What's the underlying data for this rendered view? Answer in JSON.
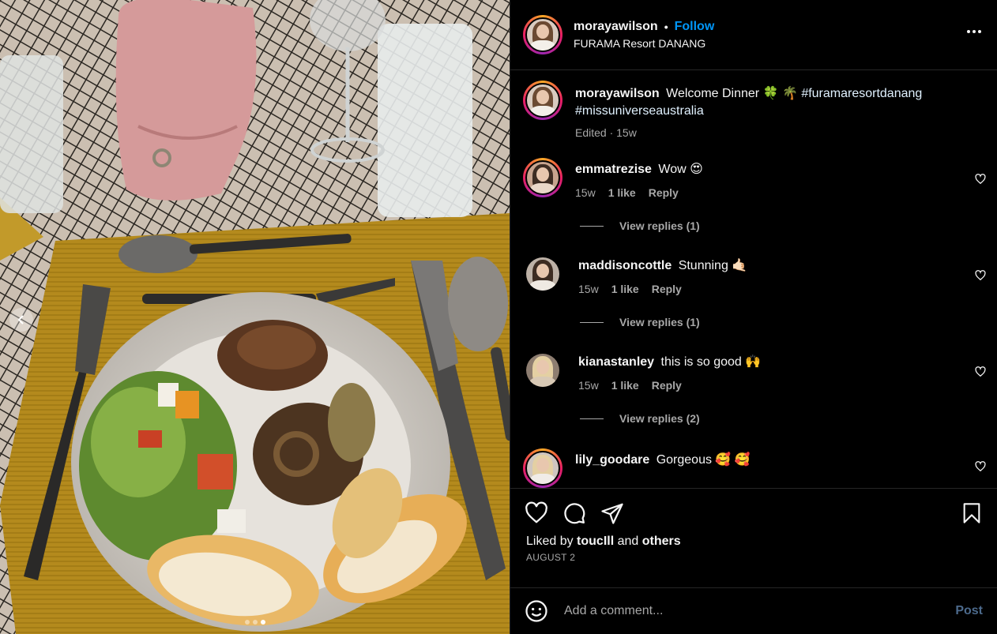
{
  "post": {
    "username": "morayawilson",
    "follow_label": "Follow",
    "separator": "•",
    "location": "FURAMA Resort DANANG",
    "carousel": {
      "slides": 3,
      "active_index": 2
    }
  },
  "caption": {
    "username": "morayawilson",
    "text": "Welcome Dinner 🍀 🌴",
    "hashtag_1": "#furamaresortdanang",
    "hashtag_2": "#missuniverseaustralia",
    "edited_time": "Edited · 15w"
  },
  "comments": [
    {
      "username": "emmatrezise",
      "text": "Wow 😍",
      "time": "15w",
      "likes": "1 like",
      "reply": "Reply",
      "view_replies": "View replies (1)"
    },
    {
      "username": "maddisoncottle",
      "text": "Stunning 🤙🏻",
      "time": "15w",
      "likes": "1 like",
      "reply": "Reply",
      "view_replies": "View replies (1)"
    },
    {
      "username": "kianastanley",
      "text": "this is so good 🙌",
      "time": "15w",
      "likes": "1 like",
      "reply": "Reply",
      "view_replies": "View replies (2)"
    },
    {
      "username": "lily_goodare",
      "text": "Gorgeous 🥰 🥰"
    }
  ],
  "likes": {
    "prefix": "Liked by",
    "user": "toucIll",
    "and": "and",
    "others": "others"
  },
  "date": "AUGUST 2",
  "add_comment": {
    "placeholder": "Add a comment...",
    "post_label": "Post"
  },
  "icons": {
    "more": "more-options-icon",
    "like": "heart-icon",
    "comment": "comment-icon",
    "share": "share-icon",
    "save": "bookmark-icon",
    "emoji": "emoji-icon",
    "prev": "chevron-left-icon"
  },
  "colors": {
    "accent": "#0095f6",
    "background": "#000000",
    "muted": "#a8a8a8",
    "divider": "#262626"
  }
}
